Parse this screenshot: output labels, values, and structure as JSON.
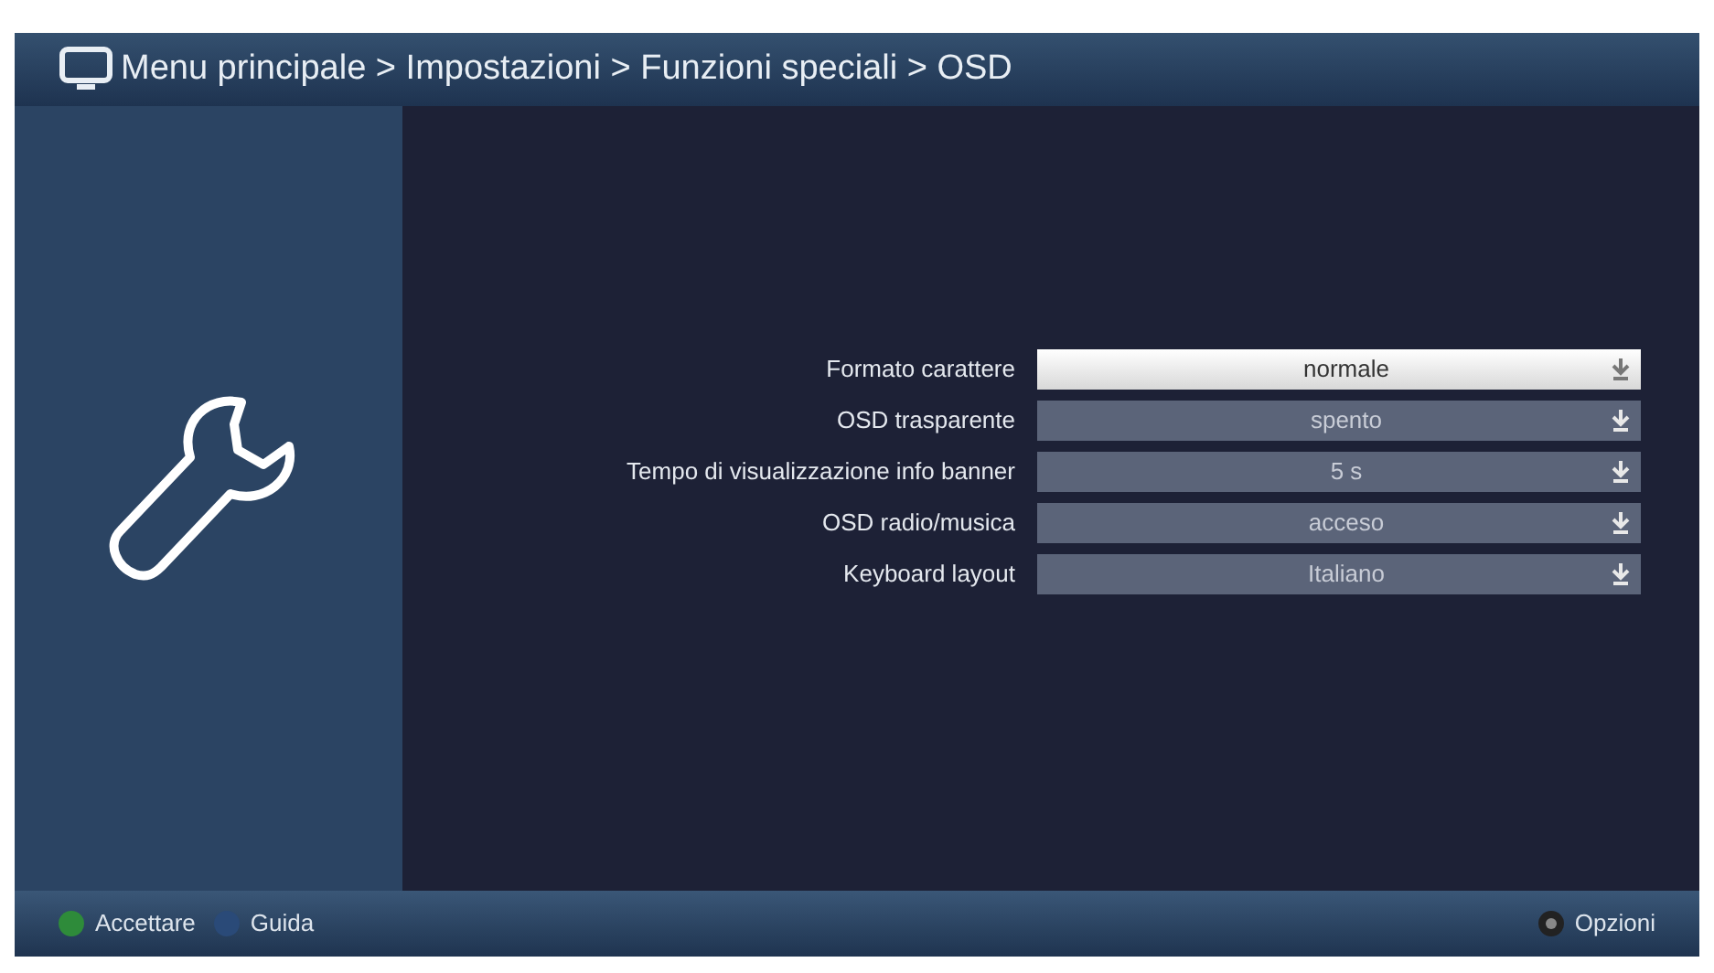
{
  "header": {
    "breadcrumb": "Menu principale > Impostazioni > Funzioni speciali > OSD"
  },
  "settings": [
    {
      "label": "Formato carattere",
      "value": "normale",
      "selected": true
    },
    {
      "label": "OSD trasparente",
      "value": "spento",
      "selected": false
    },
    {
      "label": "Tempo di visualizzazione info banner",
      "value": "5 s",
      "selected": false
    },
    {
      "label": "OSD radio/musica",
      "value": "acceso",
      "selected": false
    },
    {
      "label": "Keyboard layout",
      "value": "Italiano",
      "selected": false
    }
  ],
  "footer": {
    "actions": [
      {
        "label": "Accettare",
        "color": "#2e8b3a"
      },
      {
        "label": "Guida",
        "color": "#2a4a78"
      }
    ],
    "options": "Opzioni"
  }
}
